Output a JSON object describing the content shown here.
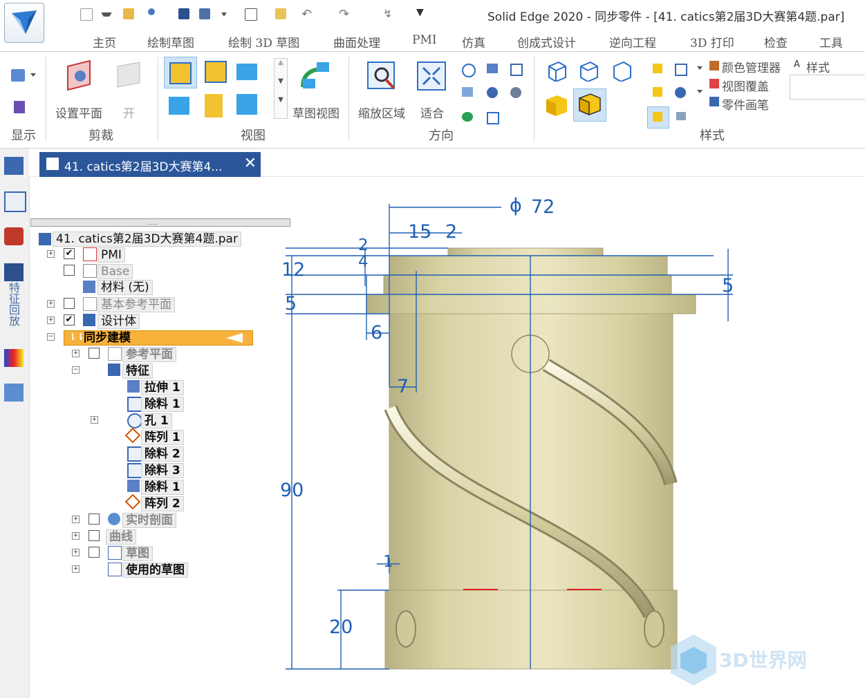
{
  "window": {
    "title": "Solid Edge 2020 - 同步零件 - [41. catics第2届3D大赛第4题.par]"
  },
  "menu": {
    "items": [
      "主页",
      "绘制草图",
      "绘制 3D 草图",
      "曲面处理",
      "PMI",
      "仿真",
      "创成式设计",
      "逆向工程",
      "3D 打印",
      "检查",
      "工具"
    ]
  },
  "ribbon": {
    "groups": {
      "display": "显示",
      "clip": "剪裁",
      "view": "视图",
      "orientation": "方向",
      "style": "样式"
    },
    "buttons": {
      "set_plane": "设置平面",
      "open": "开",
      "sketch_view": "草图视图",
      "zoom_area": "缩放区域",
      "fit": "适合",
      "color_manager": "颜色管理器",
      "view_override": "视图覆盖",
      "part_painter": "零件画笔",
      "style_label": "样式"
    }
  },
  "left_strip": {
    "vertical_label": "特征回放"
  },
  "document_tab": {
    "label": "41. catics第2届3D大赛第4...",
    "close": "✕"
  },
  "pathfinder": {
    "root": "41. catics第2届3D大赛第4题.par",
    "pmi": "PMI",
    "base": "Base",
    "material": "材料 (无)",
    "base_ref": "基本参考平面",
    "design_body": "设计体",
    "sync": "同步建模",
    "ref_planes": "参考平面",
    "features": "特征",
    "feature_items": [
      "拉伸 1",
      "除料 1",
      "孔 1",
      "阵列 1",
      "除料 2",
      "除料 3",
      "除料 1",
      "阵列 2"
    ],
    "live_section": "实时剖面",
    "curves": "曲线",
    "sketches": "草图",
    "used_sketches": "使用的草图"
  },
  "dimensions": {
    "diameter": "72",
    "phi": "ϕ",
    "d15": "15",
    "d2": "2",
    "d2b": "2",
    "d4": "4",
    "d12": "12",
    "d5a": "5",
    "d5b": "5",
    "d6": "6",
    "d7": "7",
    "d90": "90",
    "d1": "1",
    "d20": "20"
  },
  "watermark": {
    "text": "3D世界网"
  },
  "colors": {
    "accent": "#2b579a",
    "dimension": "#1f5fb4",
    "part": "#ddd6a4",
    "highlight": "#f7b23b"
  }
}
